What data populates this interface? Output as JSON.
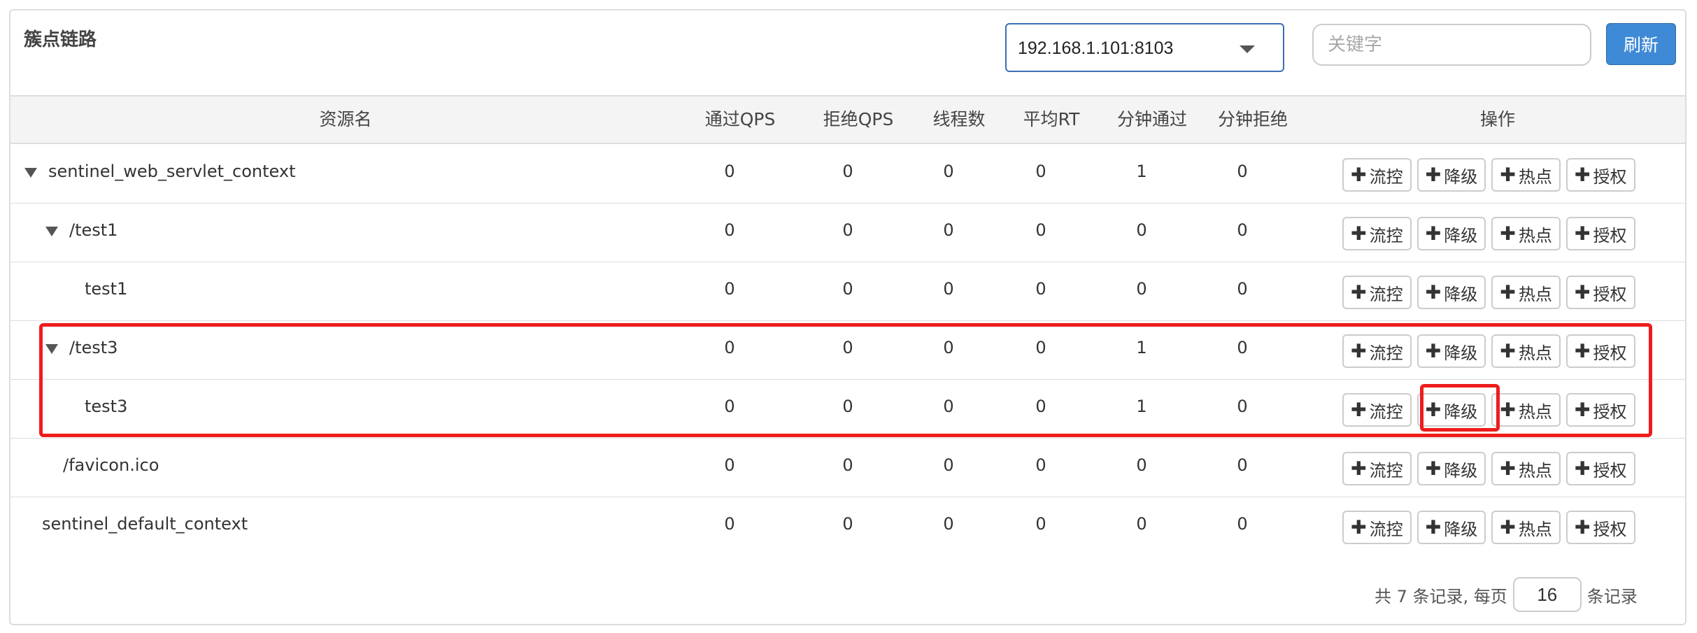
{
  "panel": {
    "title": "簇点链路"
  },
  "toolbar": {
    "machine_select": "192.168.1.101:8103",
    "keyword_placeholder": "关键字",
    "refresh_label": "刷新"
  },
  "table": {
    "headers": {
      "name": "资源名",
      "pass_qps": "通过QPS",
      "block_qps": "拒绝QPS",
      "threads": "线程数",
      "avg_rt": "平均RT",
      "minute_pass": "分钟通过",
      "minute_block": "分钟拒绝",
      "ops": "操作"
    },
    "op_buttons": {
      "plus": "✚",
      "flow": "流控",
      "degrade": "降级",
      "hot": "热点",
      "auth": "授权"
    },
    "rows": [
      {
        "name": "sentinel_web_servlet_context",
        "pass_qps": "0",
        "block_qps": "0",
        "threads": "0",
        "avg_rt": "0",
        "minute_pass": "1",
        "minute_block": "0"
      },
      {
        "name": "/test1",
        "pass_qps": "0",
        "block_qps": "0",
        "threads": "0",
        "avg_rt": "0",
        "minute_pass": "0",
        "minute_block": "0"
      },
      {
        "name": "test1",
        "pass_qps": "0",
        "block_qps": "0",
        "threads": "0",
        "avg_rt": "0",
        "minute_pass": "0",
        "minute_block": "0"
      },
      {
        "name": "/test3",
        "pass_qps": "0",
        "block_qps": "0",
        "threads": "0",
        "avg_rt": "0",
        "minute_pass": "1",
        "minute_block": "0"
      },
      {
        "name": "test3",
        "pass_qps": "0",
        "block_qps": "0",
        "threads": "0",
        "avg_rt": "0",
        "minute_pass": "1",
        "minute_block": "0"
      },
      {
        "name": "/favicon.ico",
        "pass_qps": "0",
        "block_qps": "0",
        "threads": "0",
        "avg_rt": "0",
        "minute_pass": "0",
        "minute_block": "0"
      },
      {
        "name": "sentinel_default_context",
        "pass_qps": "0",
        "block_qps": "0",
        "threads": "0",
        "avg_rt": "0",
        "minute_pass": "0",
        "minute_block": "0"
      }
    ]
  },
  "footer": {
    "total_text": "共 7 条记录, 每页",
    "page_size": "16",
    "suffix": "条记录"
  },
  "colors": {
    "primary": "#3f8ad6",
    "highlight": "#ee1c1c"
  }
}
